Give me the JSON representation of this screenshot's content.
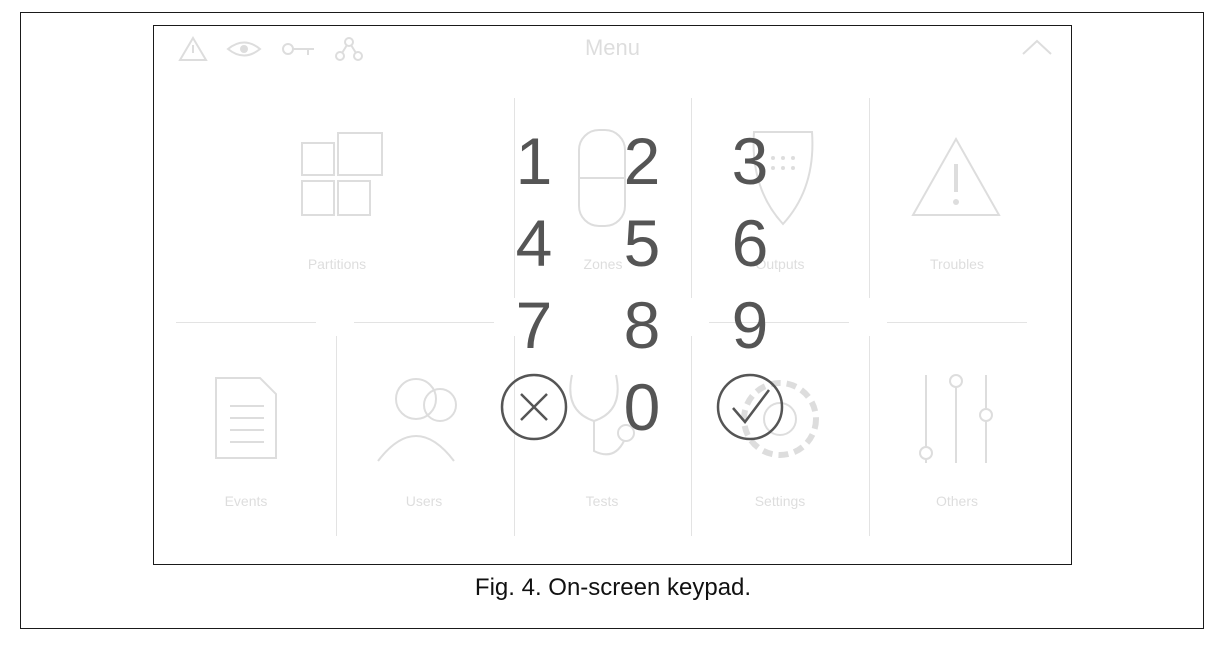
{
  "menu": {
    "title": "Menu",
    "status_icons": [
      "warning-icon",
      "eye-icon",
      "key-icon",
      "network-icon"
    ],
    "tiles": [
      {
        "label": "Partitions",
        "icon": "partitions-icon"
      },
      {
        "label": "Zones",
        "icon": "zones-icon"
      },
      {
        "label": "Outputs",
        "icon": "outputs-icon"
      },
      {
        "label": "Troubles",
        "icon": "troubles-icon"
      },
      {
        "label": "Events",
        "icon": "events-icon"
      },
      {
        "label": "Users",
        "icon": "users-icon"
      },
      {
        "label": "Tests",
        "icon": "tests-icon"
      },
      {
        "label": "Settings",
        "icon": "settings-icon"
      },
      {
        "label": "Others",
        "icon": "others-icon"
      }
    ]
  },
  "keypad": {
    "digits": [
      "1",
      "2",
      "3",
      "4",
      "5",
      "6",
      "7",
      "8",
      "9",
      "0"
    ],
    "cancel_icon": "cancel-icon",
    "confirm_icon": "confirm-icon"
  },
  "caption": "Fig. 4. On-screen keypad.",
  "colors": {
    "keypad_text": "#555555",
    "frame": "#1a1a1a"
  }
}
